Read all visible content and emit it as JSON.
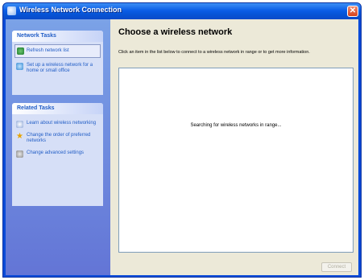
{
  "window": {
    "title": "Wireless Network Connection",
    "close_glyph": "✕"
  },
  "sidebar": {
    "network_tasks": {
      "header": "Network Tasks",
      "items": [
        {
          "label": "Refresh network list",
          "icon": "refresh-icon"
        },
        {
          "label": "Set up a wireless network for a home or small office",
          "icon": "setup-icon"
        }
      ]
    },
    "related_tasks": {
      "header": "Related Tasks",
      "items": [
        {
          "label": "Learn about wireless networking",
          "icon": "info-icon"
        },
        {
          "label": "Change the order of preferred networks",
          "icon": "star-icon",
          "glyph": "★"
        },
        {
          "label": "Change advanced settings",
          "icon": "settings-icon"
        }
      ]
    }
  },
  "main": {
    "title": "Choose a wireless network",
    "description": "Click an item in the list below to connect to a wireless network in range or to get more information.",
    "list_status": "Searching for wireless networks in range...",
    "connect_label": "Connect"
  }
}
